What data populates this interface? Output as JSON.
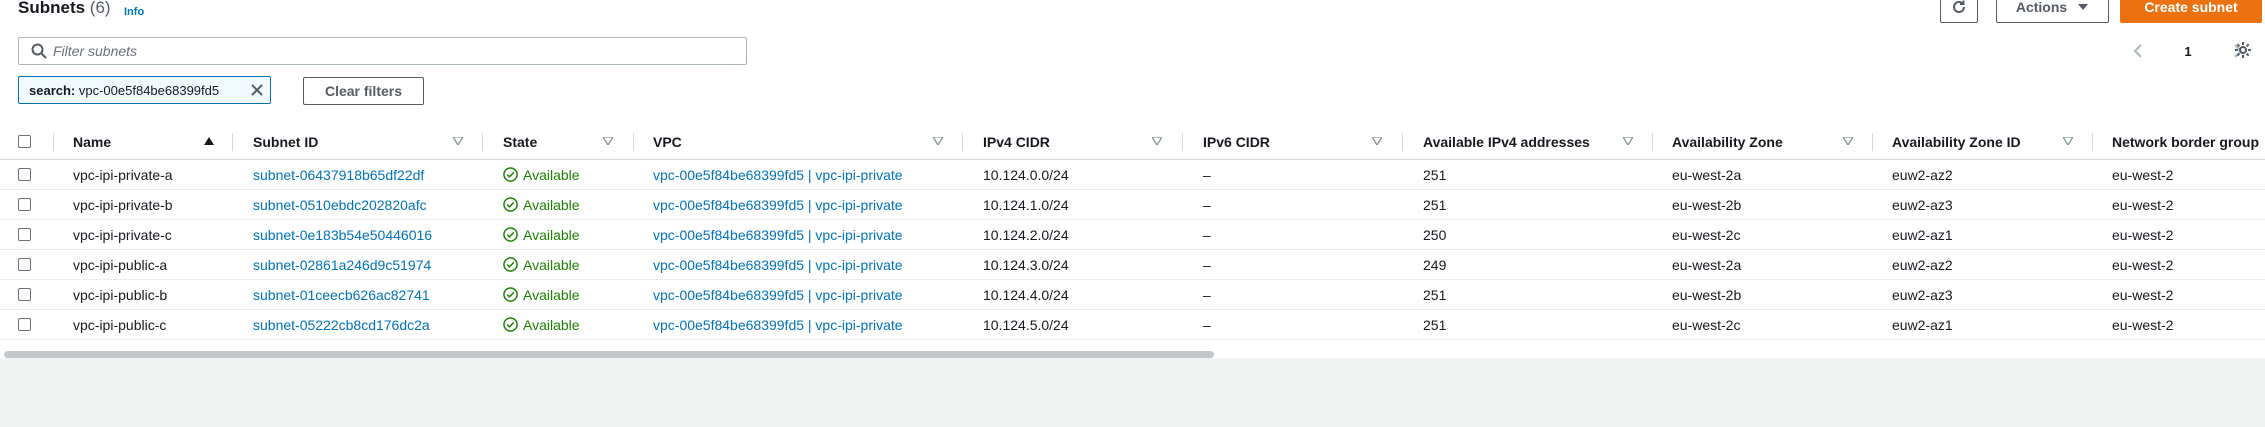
{
  "header": {
    "title": "Subnets",
    "count": "(6)",
    "info": "Info",
    "actions_label": "Actions",
    "create_label": "Create subnet"
  },
  "search": {
    "placeholder": "Filter subnets",
    "value": ""
  },
  "filter_token": {
    "key": "search:",
    "value": "vpc-00e5f84be68399fd5"
  },
  "clear_filters_label": "Clear filters",
  "pagination": {
    "current_page": "1"
  },
  "icons": {
    "refresh": "refresh-icon",
    "dropdown": "caret-down-icon",
    "search": "search-icon",
    "dismiss": "close-icon",
    "prev": "chevron-left-icon",
    "next": "chevron-right-icon",
    "settings": "gear-icon",
    "status": "check-circle-icon",
    "sort": "sort-icon"
  },
  "colors": {
    "primary": "#ec7211",
    "link": "#0073bb",
    "success": "#1d8102"
  },
  "table": {
    "columns": [
      "Name",
      "Subnet ID",
      "State",
      "VPC",
      "IPv4 CIDR",
      "IPv6 CIDR",
      "Available IPv4 addresses",
      "Availability Zone",
      "Availability Zone ID",
      "Network border group"
    ],
    "sorted_by": "Name",
    "rows": [
      {
        "name": "vpc-ipi-private-a",
        "subnet_id": "subnet-06437918b65df22df",
        "state": "Available",
        "vpc": "vpc-00e5f84be68399fd5 | vpc-ipi-private",
        "ipv4": "10.124.0.0/24",
        "ipv6": "–",
        "available": "251",
        "az": "eu-west-2a",
        "az_id": "euw2-az2",
        "nbg": "eu-west-2"
      },
      {
        "name": "vpc-ipi-private-b",
        "subnet_id": "subnet-0510ebdc202820afc",
        "state": "Available",
        "vpc": "vpc-00e5f84be68399fd5 | vpc-ipi-private",
        "ipv4": "10.124.1.0/24",
        "ipv6": "–",
        "available": "251",
        "az": "eu-west-2b",
        "az_id": "euw2-az3",
        "nbg": "eu-west-2"
      },
      {
        "name": "vpc-ipi-private-c",
        "subnet_id": "subnet-0e183b54e50446016",
        "state": "Available",
        "vpc": "vpc-00e5f84be68399fd5 | vpc-ipi-private",
        "ipv4": "10.124.2.0/24",
        "ipv6": "–",
        "available": "250",
        "az": "eu-west-2c",
        "az_id": "euw2-az1",
        "nbg": "eu-west-2"
      },
      {
        "name": "vpc-ipi-public-a",
        "subnet_id": "subnet-02861a246d9c51974",
        "state": "Available",
        "vpc": "vpc-00e5f84be68399fd5 | vpc-ipi-private",
        "ipv4": "10.124.3.0/24",
        "ipv6": "–",
        "available": "249",
        "az": "eu-west-2a",
        "az_id": "euw2-az2",
        "nbg": "eu-west-2"
      },
      {
        "name": "vpc-ipi-public-b",
        "subnet_id": "subnet-01ceecb626ac82741",
        "state": "Available",
        "vpc": "vpc-00e5f84be68399fd5 | vpc-ipi-private",
        "ipv4": "10.124.4.0/24",
        "ipv6": "–",
        "available": "251",
        "az": "eu-west-2b",
        "az_id": "euw2-az3",
        "nbg": "eu-west-2"
      },
      {
        "name": "vpc-ipi-public-c",
        "subnet_id": "subnet-05222cb8cd176dc2a",
        "state": "Available",
        "vpc": "vpc-00e5f84be68399fd5 | vpc-ipi-private",
        "ipv4": "10.124.5.0/24",
        "ipv6": "–",
        "available": "251",
        "az": "eu-west-2c",
        "az_id": "euw2-az1",
        "nbg": "eu-west-2"
      }
    ]
  }
}
